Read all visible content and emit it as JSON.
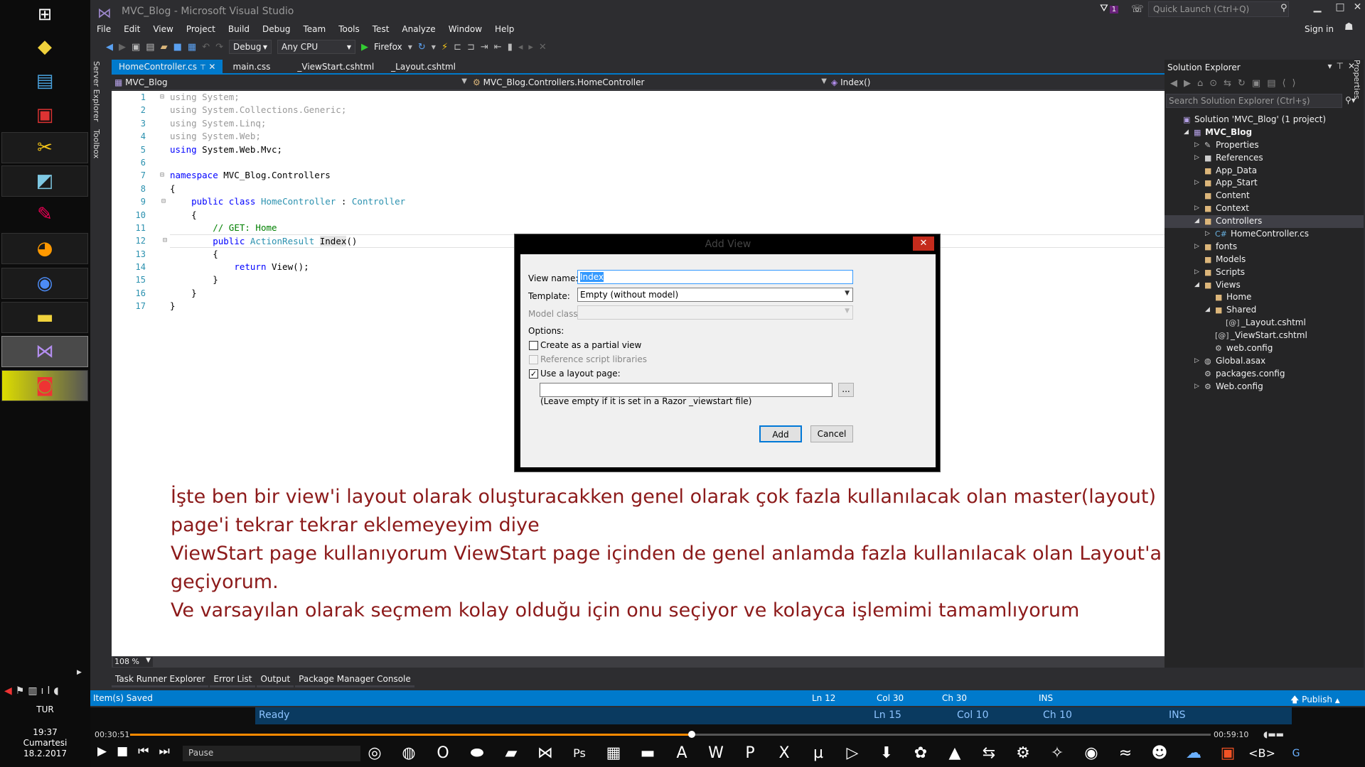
{
  "window": {
    "title": "MVC_Blog - Microsoft Visual Studio",
    "notification_count": "1",
    "quick_launch_placeholder": "Quick Launch (Ctrl+Q)",
    "sign_in": "Sign in"
  },
  "menu": [
    "File",
    "Edit",
    "View",
    "Project",
    "Build",
    "Debug",
    "Team",
    "Tools",
    "Test",
    "Analyze",
    "Window",
    "Help"
  ],
  "toolbar": {
    "config": "Debug",
    "platform": "Any CPU",
    "browser": "Firefox"
  },
  "side_tabs": {
    "server_explorer": "Server Explorer",
    "toolbox": "Toolbox",
    "properties": "Properties"
  },
  "doc_tabs": [
    {
      "label": "HomeController.cs",
      "active": true
    },
    {
      "label": "main.css",
      "active": false
    },
    {
      "label": "_ViewStart.cshtml",
      "active": false
    },
    {
      "label": "_Layout.cshtml",
      "active": false
    }
  ],
  "navbar": {
    "project": "MVC_Blog",
    "type": "MVC_Blog.Controllers.HomeController",
    "member": "Index()"
  },
  "editor": {
    "zoom": "108 %",
    "line_numbers": [
      "1",
      "2",
      "3",
      "4",
      "5",
      "6",
      "7",
      "8",
      "9",
      "10",
      "11",
      "12",
      "13",
      "14",
      "15",
      "16",
      "17"
    ],
    "code_lines": [
      [
        {
          "t": "using System;",
          "c": "gr"
        }
      ],
      [
        {
          "t": "using System.Collections.Generic;",
          "c": "gr"
        }
      ],
      [
        {
          "t": "using System.Linq;",
          "c": "gr"
        }
      ],
      [
        {
          "t": "using System.Web;",
          "c": "gr"
        }
      ],
      [
        {
          "t": "using",
          "c": "kw"
        },
        {
          "t": " System.Web.Mvc;",
          "c": ""
        }
      ],
      [],
      [
        {
          "t": "namespace",
          "c": "kw"
        },
        {
          "t": " MVC_Blog.Controllers",
          "c": ""
        }
      ],
      [
        {
          "t": "{",
          "c": ""
        }
      ],
      [
        {
          "t": "    ",
          "c": ""
        },
        {
          "t": "public",
          "c": "kw"
        },
        {
          "t": " ",
          "c": ""
        },
        {
          "t": "class",
          "c": "kw"
        },
        {
          "t": " ",
          "c": ""
        },
        {
          "t": "HomeController",
          "c": "ty"
        },
        {
          "t": " : ",
          "c": ""
        },
        {
          "t": "Controller",
          "c": "ty"
        }
      ],
      [
        {
          "t": "    {",
          "c": ""
        }
      ],
      [
        {
          "t": "        ",
          "c": ""
        },
        {
          "t": "// GET: Home",
          "c": "cm"
        }
      ],
      [
        {
          "t": "        ",
          "c": ""
        },
        {
          "t": "public",
          "c": "kw"
        },
        {
          "t": " ",
          "c": ""
        },
        {
          "t": "ActionResult",
          "c": "ty"
        },
        {
          "t": " ",
          "c": ""
        },
        {
          "t": "Index",
          "c": "hl"
        },
        {
          "t": "()",
          "c": ""
        }
      ],
      [
        {
          "t": "        {",
          "c": ""
        }
      ],
      [
        {
          "t": "            ",
          "c": ""
        },
        {
          "t": "return",
          "c": "kw"
        },
        {
          "t": " View();",
          "c": ""
        }
      ],
      [
        {
          "t": "        }",
          "c": ""
        }
      ],
      [
        {
          "t": "    }",
          "c": ""
        }
      ],
      [
        {
          "t": "}",
          "c": ""
        }
      ]
    ]
  },
  "bottom_tabs": [
    "Task Runner Explorer",
    "Error List",
    "Output",
    "Package Manager Console"
  ],
  "solution_explorer": {
    "title": "Solution Explorer",
    "search_placeholder": "Search Solution Explorer (Ctrl+ş)",
    "items": [
      {
        "label": "Solution 'MVC_Blog' (1 project)",
        "depth": 0,
        "exp": "",
        "icon": "solution-icon",
        "cls": "proj",
        "glyph": "▣"
      },
      {
        "label": "MVC_Blog",
        "depth": 1,
        "exp": "◢",
        "icon": "project-icon",
        "cls": "proj",
        "glyph": "▦"
      },
      {
        "label": "Properties",
        "depth": 2,
        "exp": "▷",
        "icon": "wrench-icon",
        "cls": "cfg",
        "glyph": "✎"
      },
      {
        "label": "References",
        "depth": 2,
        "exp": "▷",
        "icon": "references-icon",
        "cls": "cfg",
        "glyph": "■"
      },
      {
        "label": "App_Data",
        "depth": 2,
        "exp": "",
        "icon": "folder-icon",
        "cls": "folder",
        "glyph": "■"
      },
      {
        "label": "App_Start",
        "depth": 2,
        "exp": "▷",
        "icon": "folder-icon",
        "cls": "folder",
        "glyph": "■"
      },
      {
        "label": "Content",
        "depth": 2,
        "exp": "",
        "icon": "folder-icon",
        "cls": "folder",
        "glyph": "■"
      },
      {
        "label": "Context",
        "depth": 2,
        "exp": "▷",
        "icon": "folder-icon",
        "cls": "folder",
        "glyph": "■"
      },
      {
        "label": "Controllers",
        "depth": 2,
        "exp": "◢",
        "icon": "folder-icon",
        "cls": "folder",
        "glyph": "■",
        "selected": true
      },
      {
        "label": "HomeController.cs",
        "depth": 3,
        "exp": "▷",
        "icon": "csharp-file-icon",
        "cls": "csfile",
        "glyph": "C#"
      },
      {
        "label": "fonts",
        "depth": 2,
        "exp": "▷",
        "icon": "folder-icon",
        "cls": "folder",
        "glyph": "■"
      },
      {
        "label": "Models",
        "depth": 2,
        "exp": "",
        "icon": "folder-icon",
        "cls": "folder",
        "glyph": "■"
      },
      {
        "label": "Scripts",
        "depth": 2,
        "exp": "▷",
        "icon": "folder-icon",
        "cls": "folder",
        "glyph": "■"
      },
      {
        "label": "Views",
        "depth": 2,
        "exp": "◢",
        "icon": "folder-icon",
        "cls": "folder",
        "glyph": "■"
      },
      {
        "label": "Home",
        "depth": 3,
        "exp": "",
        "icon": "folder-icon",
        "cls": "folder",
        "glyph": "■"
      },
      {
        "label": "Shared",
        "depth": 3,
        "exp": "◢",
        "icon": "folder-icon",
        "cls": "folder",
        "glyph": "■"
      },
      {
        "label": "_Layout.cshtml",
        "depth": 4,
        "exp": "",
        "icon": "razor-file-icon",
        "cls": "cfg",
        "glyph": "[@]"
      },
      {
        "label": "_ViewStart.cshtml",
        "depth": 3,
        "exp": "",
        "icon": "razor-file-icon",
        "cls": "cfg",
        "glyph": "[@]"
      },
      {
        "label": "web.config",
        "depth": 3,
        "exp": "",
        "icon": "config-file-icon",
        "cls": "cfg",
        "glyph": "⚙"
      },
      {
        "label": "Global.asax",
        "depth": 2,
        "exp": "▷",
        "icon": "global-icon",
        "cls": "cfg",
        "glyph": "◍"
      },
      {
        "label": "packages.config",
        "depth": 2,
        "exp": "",
        "icon": "config-file-icon",
        "cls": "cfg",
        "glyph": "⚙"
      },
      {
        "label": "Web.config",
        "depth": 2,
        "exp": "▷",
        "icon": "config-file-icon",
        "cls": "cfg",
        "glyph": "⚙"
      }
    ]
  },
  "status": {
    "message": "Item(s) Saved",
    "ln": "Ln 12",
    "col": "Col 30",
    "ch": "Ch 30",
    "mode": "INS",
    "publish": "Publish"
  },
  "dialog": {
    "title": "Add View",
    "view_name_label": "View name:",
    "view_name_value": "Index",
    "template_label": "Template:",
    "template_value": "Empty (without model)",
    "model_class_label": "Model class:",
    "options_label": "Options:",
    "partial_label": "Create as a partial view",
    "partial_checked": false,
    "scripts_label": "Reference script libraries",
    "scripts_checked": false,
    "layout_label": "Use a layout page:",
    "layout_checked": true,
    "layout_value": "",
    "browse_label": "...",
    "hint": "(Leave empty if it is set in a Razor _viewstart file)",
    "add_label": "Add",
    "cancel_label": "Cancel"
  },
  "overlay_text": [
    "İşte ben bir view'i layout olarak oluşturacakken genel olarak çok fazla kullanılacak olan master(layout)",
    "page'i tekrar tekrar eklemeyeyim diye",
    "ViewStart page kullanıyorum ViewStart page içinden de genel anlamda fazla kullanılacak olan Layout'a",
    "geçiyorum.",
    "Ve varsayılan olarak seçmem kolay olduğu için onu seçiyor ve kolayca işlemimi tamamlıyorum"
  ],
  "player": {
    "time_elapsed": "00:30:51",
    "time_total": "00:59:10",
    "progress_fraction": 0.52,
    "status": "Pause",
    "ghost_status": {
      "ready": "Ready",
      "ln": "Ln 15",
      "col": "Col 10",
      "ch": "Ch 10",
      "mode": "INS"
    }
  },
  "taskbar": {
    "language": "TUR",
    "time": "19:37",
    "day": "Cumartesi",
    "date": "18.2.2017"
  },
  "colors": {
    "vs_blue": "#007acc",
    "overlay_text": "#8c1a1a",
    "dialog_close": "#c42b1c"
  }
}
